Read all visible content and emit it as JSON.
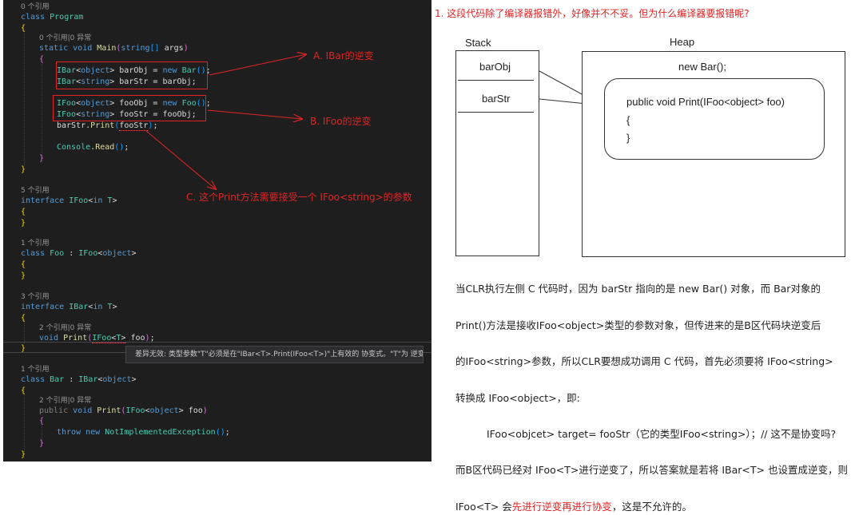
{
  "editor": {
    "lens_0": "0 个引用",
    "l_class_program": "class Program",
    "lens_main": "0 个引用|0 异常",
    "l_main_sig": "static void Main(string[] args)",
    "l_barobj": "IBar<object> barObj = new Bar();",
    "l_barstr": "IBar<string> barStr = barObj;",
    "l_fooobj": "IFoo<object> fooObj = new Foo();",
    "l_foostr": "IFoo<string> fooStr = fooObj;",
    "l_print": "barStr.Print(fooStr);",
    "l_read": "Console.Read();",
    "lens_ifoo": "5 个引用",
    "l_ifoo": "interface IFoo<in T>",
    "lens_foo": "1 个引用",
    "l_foo": "class Foo : IFoo<object>",
    "lens_ibar": "3 个引用",
    "l_ibar": "interface IBar<in T>",
    "lens_ibar_print": "2 个引用|0 异常",
    "l_ibar_print": "void Print(IFoo<T> foo);",
    "lens_bar": "1 个引用",
    "l_bar": "class Bar : IBar<object>",
    "lens_bar_print": "2 个引用|0 异常",
    "l_bar_print": "public void Print(IFoo<object> foo)",
    "l_throw": "throw new NotImplementedException();",
    "tooltip": "差异无效: 类型参数\"T\"必须是在\"IBar<T>.Print(IFoo<T>)\"上有效的 协变式。\"T\"为 逆变。"
  },
  "annotations": {
    "a": "A.  IBar的逆变",
    "b": "B. IFoo的逆变",
    "c": "C. 这个Print方法需要接受一个 IFoo<string>的参数"
  },
  "question": "1. 这段代码除了编译器报错外，好像并不不妥。但为什么编译器要报错呢?",
  "diagram": {
    "stack_label": "Stack",
    "heap_label": "Heap",
    "stack_items": [
      "barObj",
      "barStr"
    ],
    "heap_title": "new Bar();",
    "method_lines": [
      "public void Print(IFoo<object> foo)",
      "{",
      "}"
    ]
  },
  "explanation": {
    "p1": "当CLR执行左侧 C 代码时，因为 barStr 指向的是 new Bar() 对象，而 Bar对象的",
    "p2": "Print()方法是接收IFoo<object>类型的参数对象，但传进来的是B区代码块逆变后",
    "p3": "的IFoo<string>参数，所以CLR要想成功调用 C 代码，首先必须要将 IFoo<string>",
    "p4": "转换成 IFoo<object>，即:",
    "p5": "IFoo<objcet> target= fooStr（它的类型IFoo<string>）；// 这不是协变吗?",
    "p6": "而B区代码已经对 IFoo<T>进行逆变了，所以答案就是若将 IBar<T> 也设置成逆变，则",
    "p7a": "IFoo<T> 会",
    "p7b": "先进行逆变再进行协变",
    "p7c": "，这是不允许的。"
  },
  "colors": {
    "editor_bg": "#1e1e1e",
    "keyword": "#569cd6",
    "type": "#4ec9b0",
    "annotation_red": "#e02424"
  }
}
